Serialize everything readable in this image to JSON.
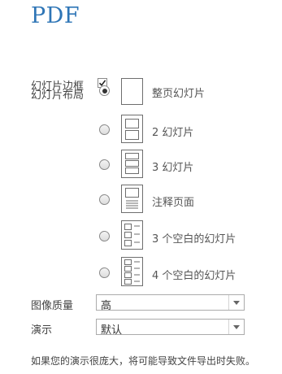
{
  "header": {
    "title": "PDF"
  },
  "frame_slides": {
    "label": "幻灯片边框",
    "checked": true
  },
  "layout": {
    "label": "幻灯片布局",
    "options": [
      {
        "label": "整页幻灯片",
        "selected": true,
        "icon": "full-page-slide-icon"
      },
      {
        "label": "2 幻灯片",
        "selected": false,
        "icon": "two-slides-icon"
      },
      {
        "label": "3 幻灯片",
        "selected": false,
        "icon": "three-slides-icon"
      },
      {
        "label": "注释页面",
        "selected": false,
        "icon": "notes-page-icon"
      },
      {
        "label": "3 个空白的幻灯片",
        "selected": false,
        "icon": "three-blank-slides-icon"
      },
      {
        "label": "4 个空白的幻灯片",
        "selected": false,
        "icon": "four-blank-slides-icon"
      }
    ]
  },
  "image_quality": {
    "label": "图像质量",
    "value": "高"
  },
  "presentation": {
    "label": "演示",
    "value": "默认"
  },
  "footer": {
    "message": "如果您的演示很庞大，将可能导致文件导出时失败。"
  }
}
